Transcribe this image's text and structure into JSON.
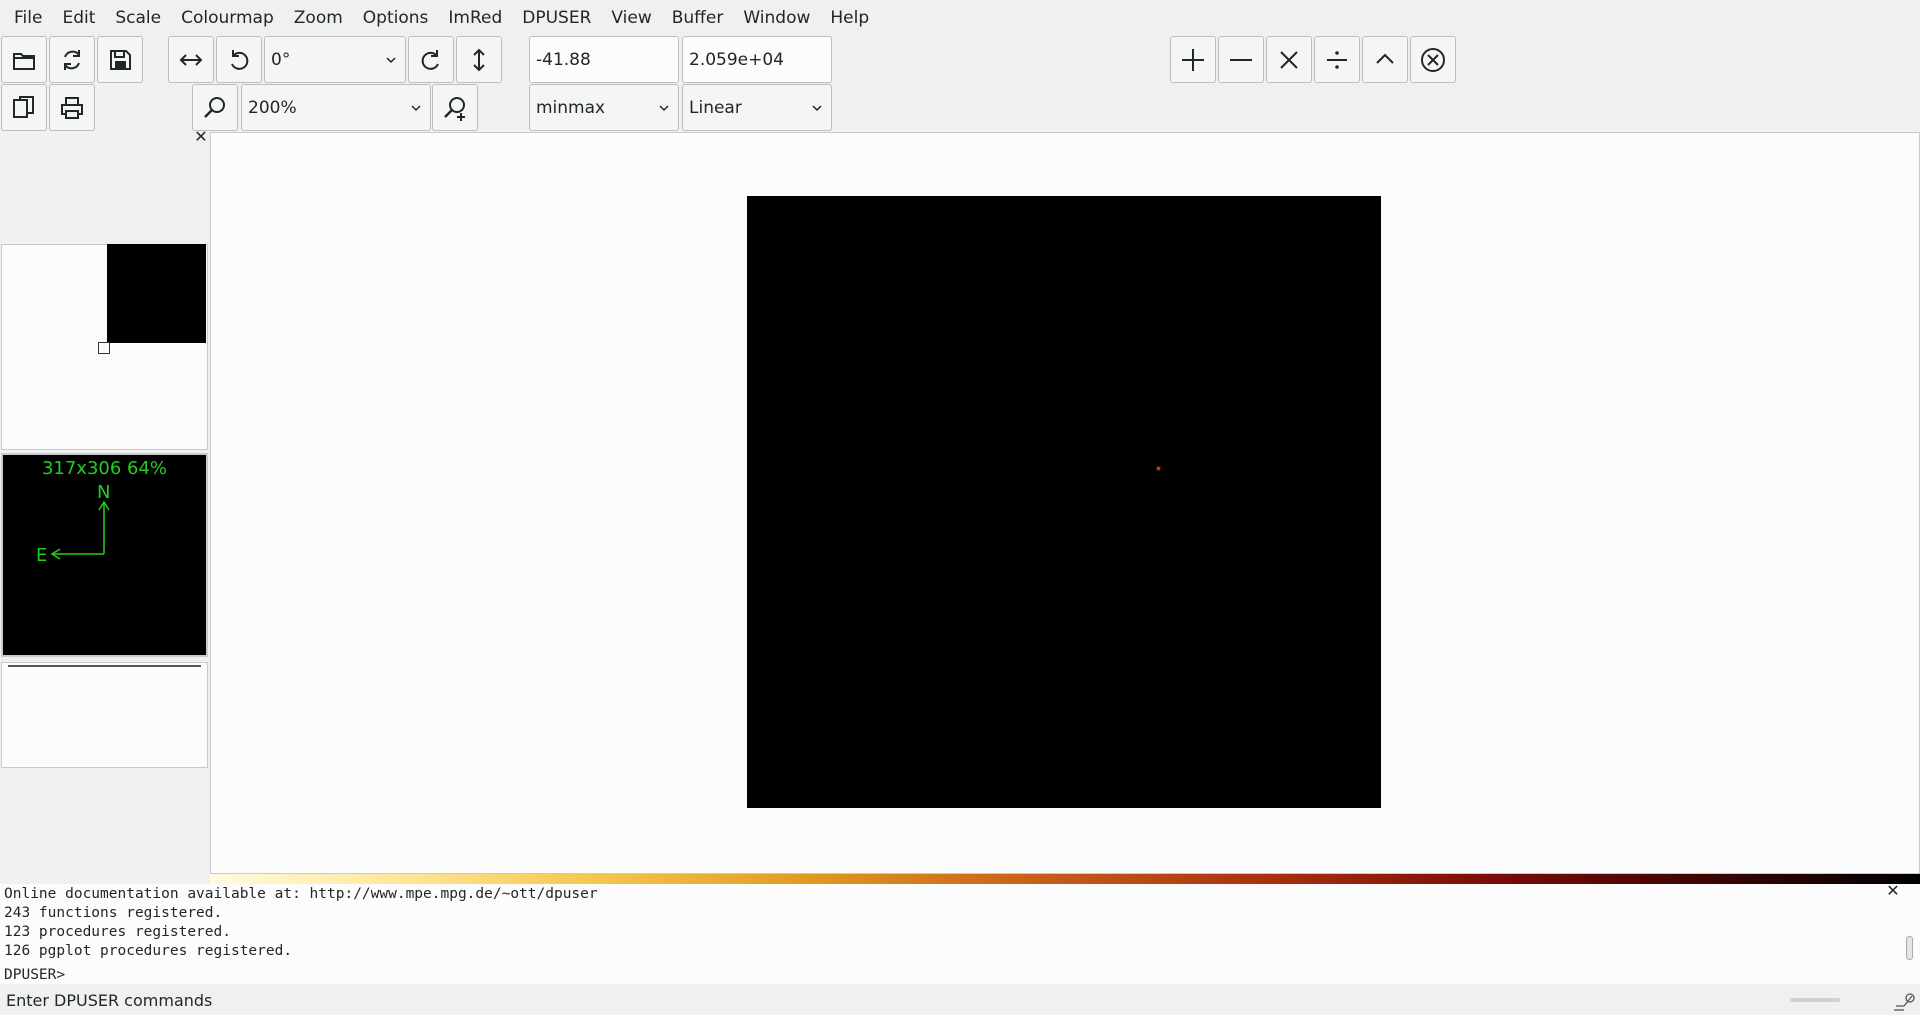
{
  "menu": [
    "File",
    "Edit",
    "Scale",
    "Colourmap",
    "Zoom",
    "Options",
    "ImRed",
    "DPUSER",
    "View",
    "Buffer",
    "Window",
    "Help"
  ],
  "toolbar": {
    "rotation_value": "0°",
    "zoom_value": "200%",
    "min_value": "-41.88",
    "max_value": "2.059e+04",
    "scale_method": "minmax",
    "scale_type": "Linear"
  },
  "dock": {
    "close_glyph": "✕",
    "orientation": {
      "info": "317x306  64%",
      "north_label": "N",
      "east_label": "E"
    }
  },
  "console": {
    "lines": [
      "Online documentation available at: http://www.mpe.mpg.de/~ott/dpuser",
      "243 functions registered.",
      "123 procedures registered.",
      "126 pgplot procedures registered."
    ],
    "prompt": "DPUSER>",
    "close_glyph": "✕"
  },
  "status": {
    "text": "Enter DPUSER commands"
  },
  "colors": {
    "orientation_green": "#1fcf1f",
    "star": "#e53a10",
    "colormap": "heat"
  },
  "icons": {
    "file_row": [
      "open-folder-icon",
      "reload-icon",
      "save-icon"
    ],
    "file_row2": [
      "copy-icon",
      "print-icon"
    ],
    "transform": [
      "flip-horizontal-icon",
      "rotate-left-icon",
      "rotate-right-icon",
      "flip-vertical-icon"
    ],
    "zoom": [
      "zoom-out-icon",
      "zoom-in-icon"
    ],
    "operators": [
      "plus-icon",
      "minus-icon",
      "multiply-icon",
      "divide-icon",
      "power-icon",
      "clear-icon"
    ]
  }
}
